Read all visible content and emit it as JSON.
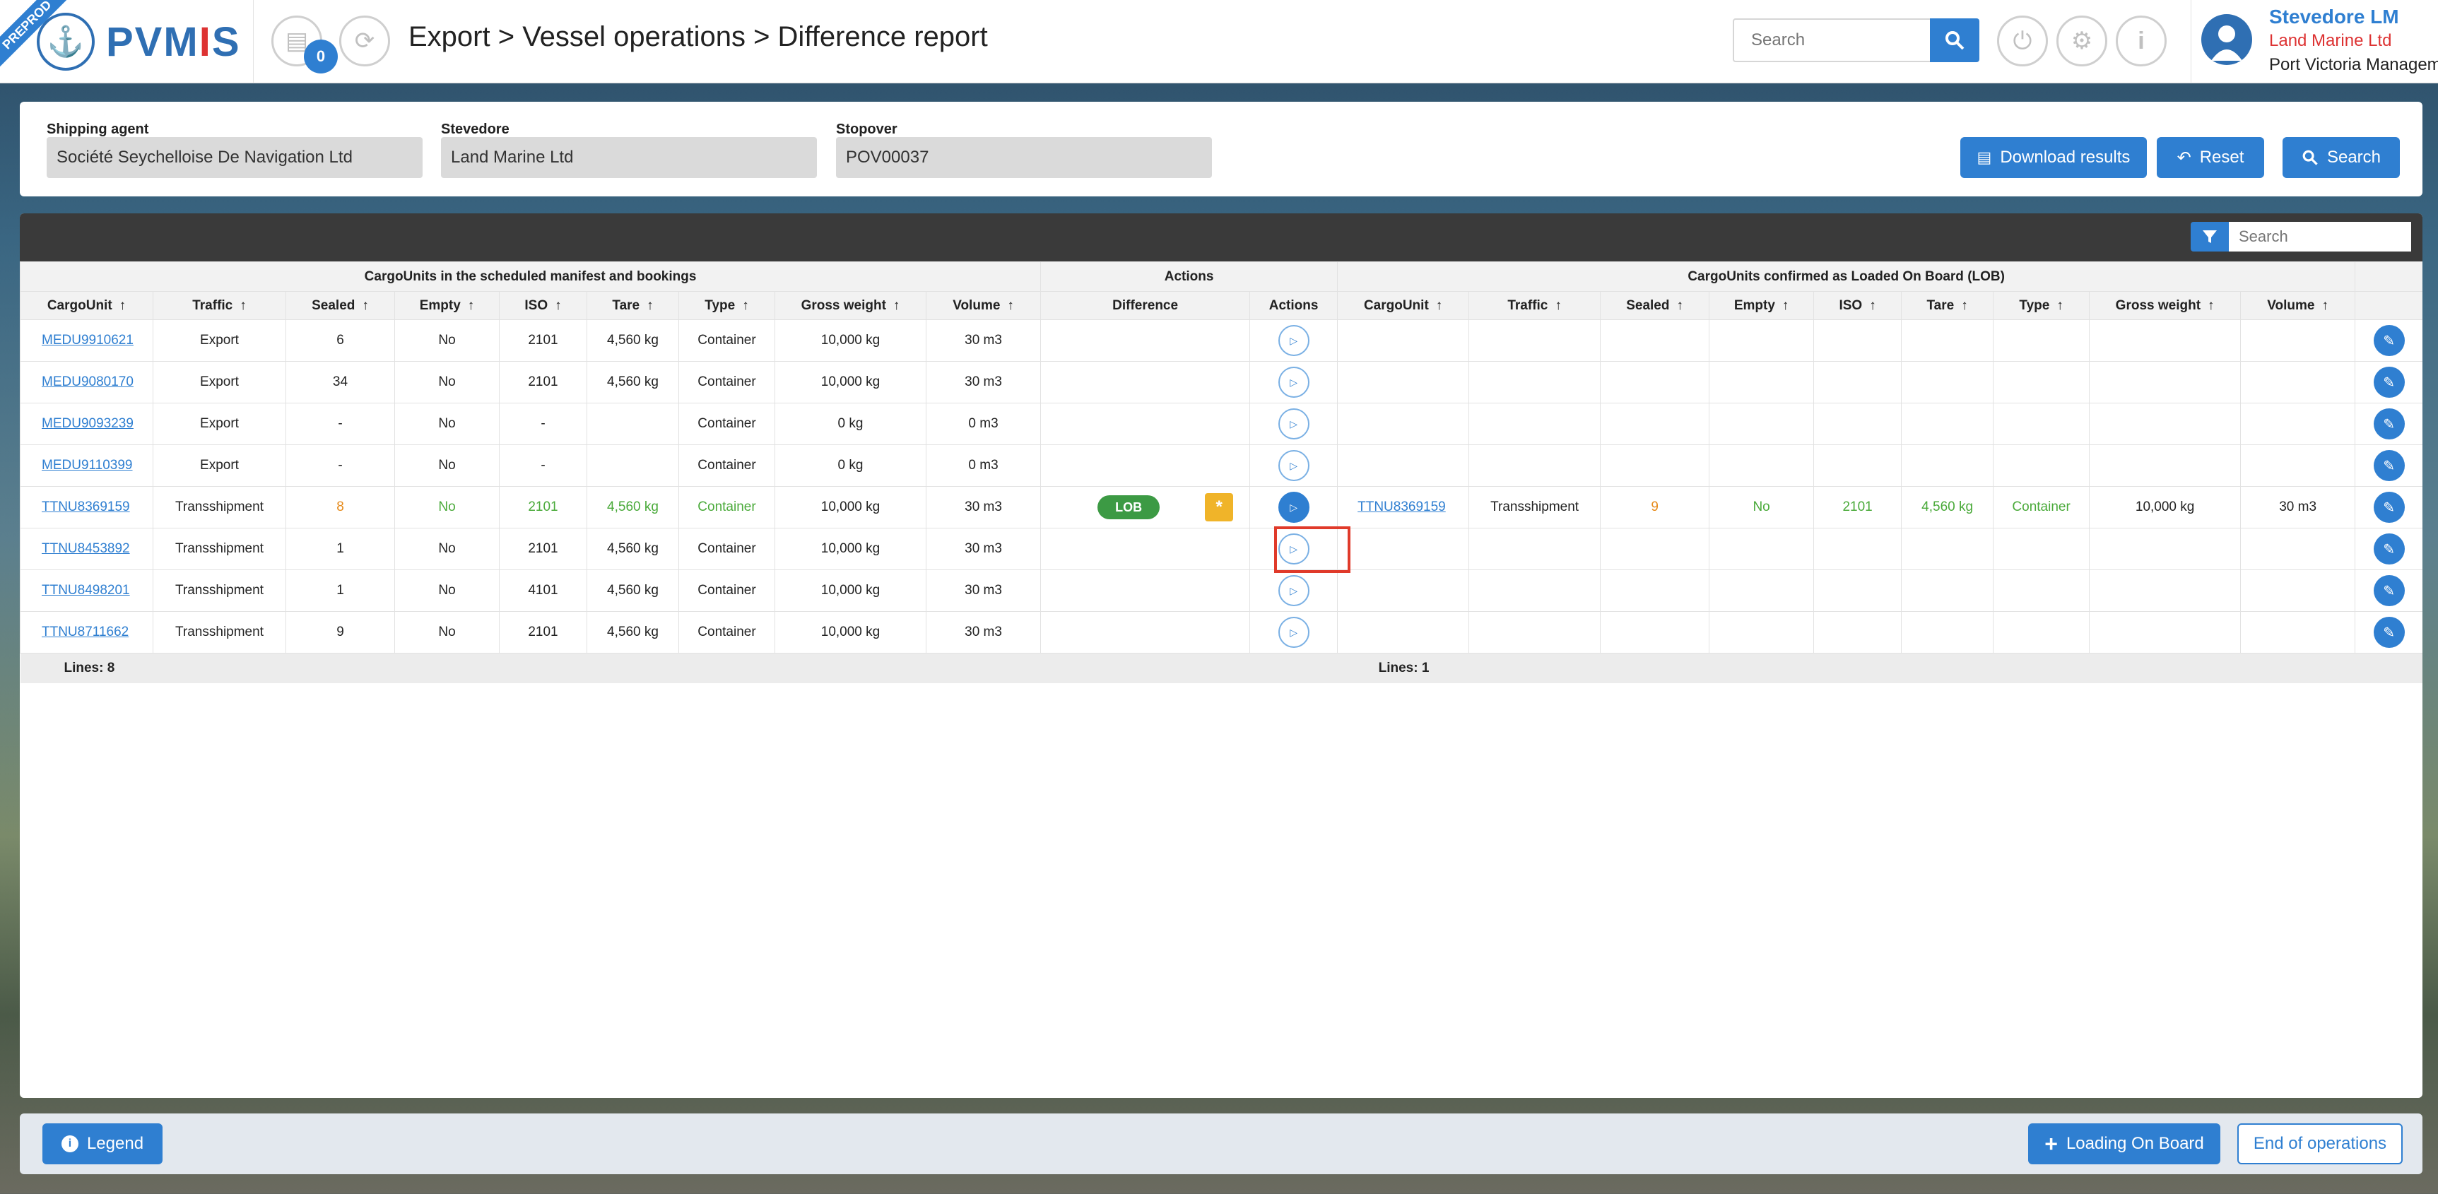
{
  "env_badge": "PREPROD",
  "app": {
    "logo_text_1": "PVM",
    "logo_text_2": "I",
    "logo_text_3": "S",
    "notification_count": "0"
  },
  "breadcrumb": "Export > Vessel operations > Difference report",
  "header_search": {
    "placeholder": "Search"
  },
  "user": {
    "name": "Stevedore LM",
    "company": "Land Marine Ltd",
    "organization": "Port Victoria Management"
  },
  "filters": {
    "shipping_agent": {
      "label": "Shipping agent",
      "value": "Société Seychelloise De Navigation Ltd"
    },
    "stevedore": {
      "label": "Stevedore",
      "value": "Land Marine Ltd"
    },
    "stopover": {
      "label": "Stopover",
      "value": "POV00037"
    },
    "download_label": "Download results",
    "reset_label": "Reset",
    "search_label": "Search"
  },
  "grid": {
    "search_placeholder": "Search",
    "groups": {
      "left": "CargoUnits in the scheduled manifest and bookings",
      "actions": "Actions",
      "right": "CargoUnits confirmed as Loaded On Board (LOB)"
    },
    "columns": {
      "cargo_unit": "CargoUnit",
      "traffic": "Traffic",
      "sealed": "Sealed",
      "empty": "Empty",
      "iso": "ISO",
      "tare": "Tare",
      "type": "Type",
      "gross_weight": "Gross weight",
      "volume": "Volume",
      "difference": "Difference",
      "actions": "Actions"
    },
    "lob_label": "LOB",
    "rows": [
      {
        "cargo_unit": "MEDU9910621",
        "traffic": "Export",
        "sealed": "6",
        "empty": "No",
        "iso": "2101",
        "tare": "4,560 kg",
        "type": "Container",
        "gross": "10,000 kg",
        "volume": "30 m3"
      },
      {
        "cargo_unit": "MEDU9080170",
        "traffic": "Export",
        "sealed": "34",
        "empty": "No",
        "iso": "2101",
        "tare": "4,560 kg",
        "type": "Container",
        "gross": "10,000 kg",
        "volume": "30 m3"
      },
      {
        "cargo_unit": "MEDU9093239",
        "traffic": "Export",
        "sealed": "-",
        "empty": "No",
        "iso": "-",
        "tare": "",
        "type": "Container",
        "gross": "0 kg",
        "volume": "0 m3"
      },
      {
        "cargo_unit": "MEDU9110399",
        "traffic": "Export",
        "sealed": "-",
        "empty": "No",
        "iso": "-",
        "tare": "",
        "type": "Container",
        "gross": "0 kg",
        "volume": "0 m3"
      },
      {
        "cargo_unit": "TTNU8369159",
        "traffic": "Transshipment",
        "sealed": "8",
        "empty": "No",
        "iso": "2101",
        "tare": "4,560 kg",
        "type": "Container",
        "gross": "10,000 kg",
        "volume": "30 m3",
        "lob": {
          "cargo_unit": "TTNU8369159",
          "traffic": "Transshipment",
          "sealed": "9",
          "empty": "No",
          "iso": "2101",
          "tare": "4,560 kg",
          "type": "Container",
          "gross": "10,000 kg",
          "volume": "30 m3"
        }
      },
      {
        "cargo_unit": "TTNU8453892",
        "traffic": "Transshipment",
        "sealed": "1",
        "empty": "No",
        "iso": "2101",
        "tare": "4,560 kg",
        "type": "Container",
        "gross": "10,000 kg",
        "volume": "30 m3"
      },
      {
        "cargo_unit": "TTNU8498201",
        "traffic": "Transshipment",
        "sealed": "1",
        "empty": "No",
        "iso": "4101",
        "tare": "4,560 kg",
        "type": "Container",
        "gross": "10,000 kg",
        "volume": "30 m3"
      },
      {
        "cargo_unit": "TTNU8711662",
        "traffic": "Transshipment",
        "sealed": "9",
        "empty": "No",
        "iso": "2101",
        "tare": "4,560 kg",
        "type": "Container",
        "gross": "10,000 kg",
        "volume": "30 m3"
      }
    ],
    "lines_left": "Lines: 8",
    "lines_right": "Lines: 1"
  },
  "footer": {
    "legend_label": "Legend",
    "loading_label": "Loading On Board",
    "end_label": "End of operations"
  }
}
